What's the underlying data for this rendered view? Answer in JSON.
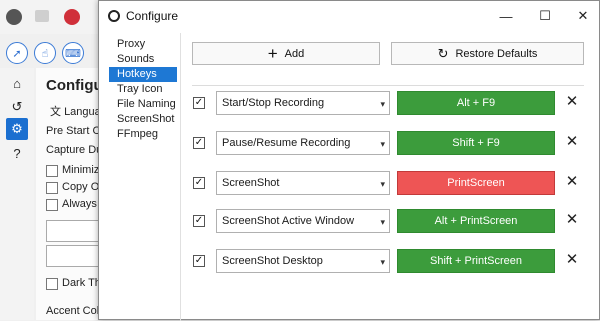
{
  "window": {
    "title": "Configure",
    "controls": {
      "minimize": "—",
      "maximize": "☐",
      "close": "✕"
    }
  },
  "nav": {
    "items": [
      "Proxy",
      "Sounds",
      "Hotkeys",
      "Tray Icon",
      "File Naming",
      "ScreenShot",
      "FFmpeg"
    ],
    "selected": "Hotkeys"
  },
  "toolbar": {
    "add_label": "Add",
    "restore_label": "Restore Defaults"
  },
  "hotkeys": [
    {
      "action": "Start/Stop Recording",
      "key": "Alt + F9",
      "status": "ok"
    },
    {
      "action": "Pause/Resume Recording",
      "key": "Shift + F9",
      "status": "ok"
    },
    {
      "action": "ScreenShot",
      "key": "PrintScreen",
      "status": "conflict"
    },
    {
      "action": "ScreenShot Active Window",
      "key": "Alt + PrintScreen",
      "status": "ok"
    },
    {
      "action": "ScreenShot Desktop",
      "key": "Shift + PrintScreen",
      "status": "ok"
    }
  ],
  "glyphs": {
    "check": "✓",
    "dropdown": "▾",
    "remove": "✕",
    "add": "+",
    "restore": "↻"
  },
  "colors": {
    "ok_key": "#3c9c3c",
    "conflict_key": "#ee5555",
    "nav_selected": "#1e78d4"
  },
  "background_app": {
    "title": "Configure",
    "language_label": "Languag",
    "pre_start_label": "Pre Start Cou",
    "capture_duration_label": "Capture Dura",
    "checkboxes": [
      "Minimize",
      "Copy Ou",
      "Always o"
    ],
    "dark_theme_label": "Dark The",
    "accent_color_label": "Accent Color"
  }
}
